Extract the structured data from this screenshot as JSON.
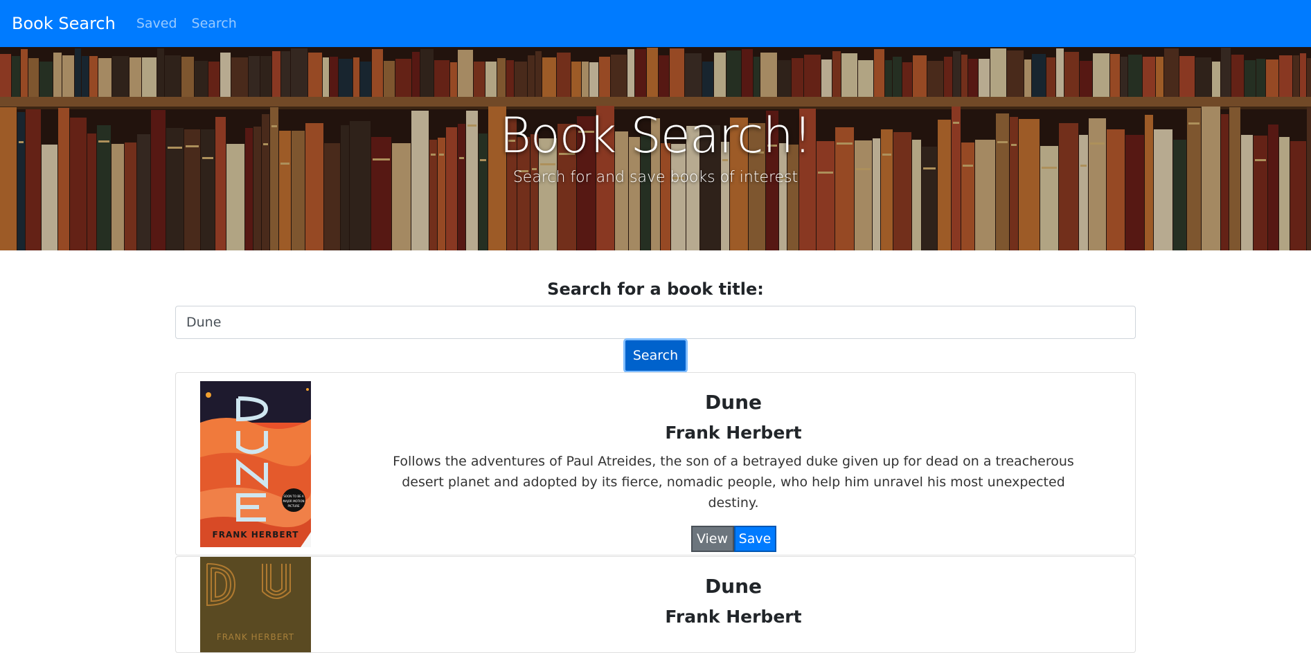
{
  "navbar": {
    "brand": "Book Search",
    "links": [
      "Saved",
      "Search"
    ]
  },
  "hero": {
    "title": "Book Search!",
    "subtitle": "Search for and save books of interest"
  },
  "search": {
    "label": "Search for a book title:",
    "value": "Dune",
    "button_label": "Search"
  },
  "results": [
    {
      "title": "Dune",
      "author": "Frank Herbert",
      "description": "Follows the adventures of Paul Atreides, the son of a betrayed duke given up for dead on a treacherous desert planet and adopted by its fierce, nomadic people, who help him unravel his most unexpected destiny.",
      "cover_text": "FRANK HERBERT",
      "cover_badge": "SOON TO BE A MAJOR MOTION PICTURE",
      "view_label": "View",
      "save_label": "Save"
    },
    {
      "title": "Dune",
      "author": "Frank Herbert",
      "cover_text": "FRANK HERBERT"
    }
  ],
  "colors": {
    "navbar": "#007bff",
    "primary_button": "#0062cc",
    "view_button": "#6c757d",
    "save_button": "#007bff"
  }
}
